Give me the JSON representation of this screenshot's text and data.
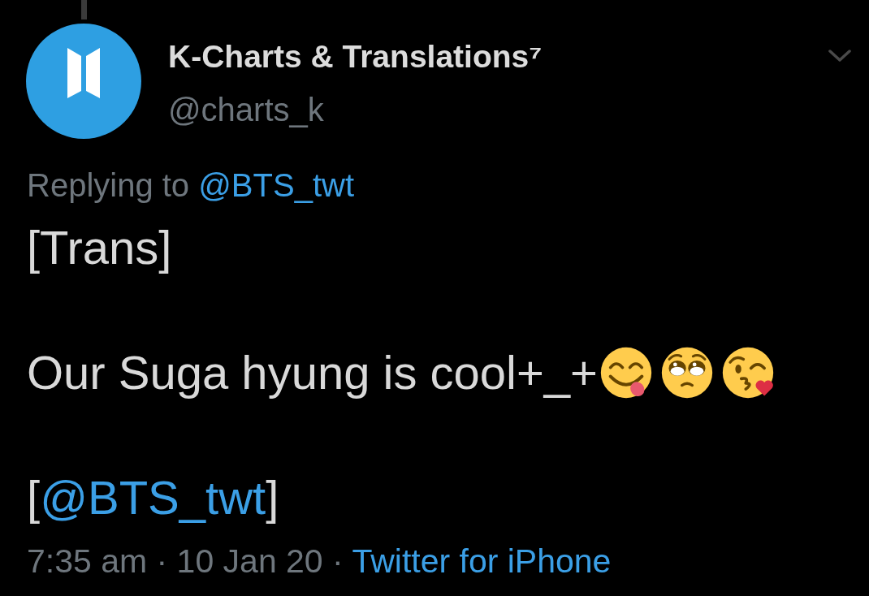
{
  "author": {
    "name": "K-Charts & Translations⁷",
    "handle": "@charts_k"
  },
  "replying_to": {
    "label": "Replying to",
    "mention": "@BTS_twt"
  },
  "tweet": {
    "paragraphs": [
      {
        "kind": "text",
        "text": "[Trans]"
      },
      {
        "kind": "text",
        "text": "Our Suga hyung is cool+_+",
        "emojis": [
          {
            "kind": "yum"
          },
          {
            "kind": "pleading"
          },
          {
            "kind": "kiss-heart"
          }
        ]
      },
      {
        "kind": "mention",
        "before": "[",
        "mention": "@BTS_twt",
        "after": "]"
      }
    ]
  },
  "meta": {
    "time_date": "7:35 am · 10 Jan 20 ·",
    "source": "Twitter for iPhone"
  }
}
